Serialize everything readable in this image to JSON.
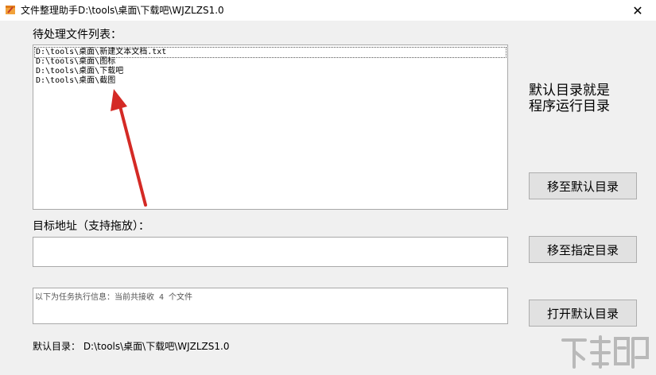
{
  "window": {
    "title": "文件整理助手D:\\tools\\桌面\\下载吧\\WJZLZS1.0",
    "close_glyph": "✕"
  },
  "labels": {
    "file_list": "待处理文件列表：",
    "target": "目标地址（支持拖放）：",
    "side_note_line1": "默认目录就是",
    "side_note_line2": "程序运行目录"
  },
  "file_list": {
    "items": [
      "D:\\tools\\桌面\\新建文本文档.txt",
      "D:\\tools\\桌面\\图标",
      "D:\\tools\\桌面\\下载吧",
      "D:\\tools\\桌面\\截图"
    ]
  },
  "target_input": {
    "value": ""
  },
  "info": {
    "text": "以下为任务执行信息：当前共接收 4 个文件"
  },
  "buttons": {
    "move_default": "移至默认目录",
    "move_specified": "移至指定目录",
    "open_default": "打开默认目录"
  },
  "footer": {
    "text": "默认目录： D:\\tools\\桌面\\下载吧\\WJZLZS1.0"
  },
  "colors": {
    "arrow": "#d42a25",
    "window_bg": "#f0f0f0"
  },
  "icons": {
    "app": "app-icon",
    "arrow": "annotation-arrow-icon",
    "watermark": "watermark-logo"
  }
}
